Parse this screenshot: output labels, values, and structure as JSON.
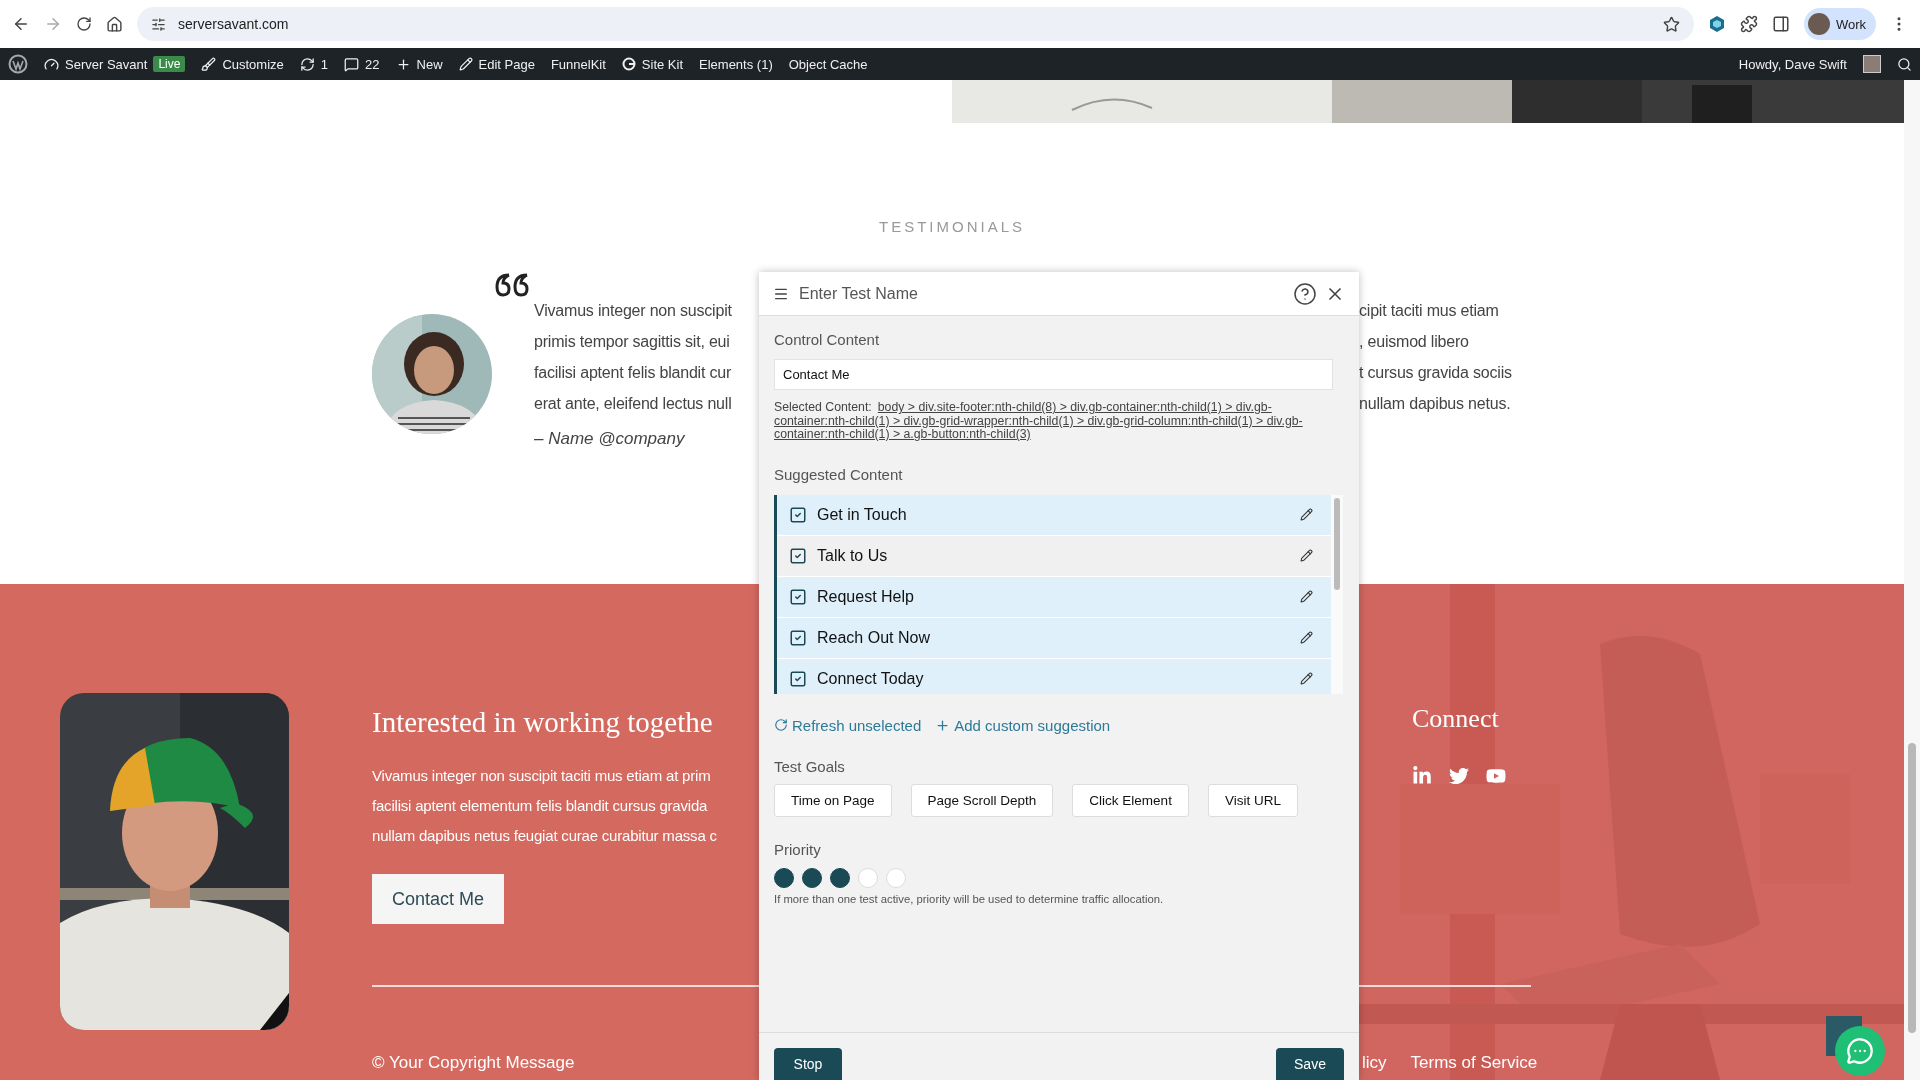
{
  "browser": {
    "url": "serversavant.com",
    "profile": "Work"
  },
  "admin_bar": {
    "items": [
      {
        "kind": "site",
        "label": "Server Savant",
        "badge": "Live"
      },
      {
        "kind": "customize",
        "label": "Customize"
      },
      {
        "kind": "updates",
        "label": "1"
      },
      {
        "kind": "comments",
        "label": "22"
      },
      {
        "kind": "new",
        "label": "New"
      },
      {
        "kind": "edit",
        "label": "Edit Page"
      },
      {
        "kind": "plain",
        "label": "FunnelKit"
      },
      {
        "kind": "sitekit",
        "label": "Site Kit"
      },
      {
        "kind": "plain",
        "label": "Elements (1)"
      },
      {
        "kind": "plain",
        "label": "Object Cache"
      }
    ],
    "greeting": "Howdy, Dave Swift"
  },
  "testimonials": {
    "heading": "TESTIMONIALS",
    "lines": [
      {
        "left": "Vivamus integer non suscipit",
        "right": "cipit taciti mus etiam"
      },
      {
        "left": "primis tempor sagittis sit, eui",
        "right": ", euismod libero"
      },
      {
        "left": "facilisi aptent felis blandit cur",
        "right": "t cursus gravida sociis"
      },
      {
        "left": "erat ante, eleifend lectus null",
        "right": "nullam dapibus netus."
      }
    ],
    "author": "– Name @company"
  },
  "footer": {
    "heading": "Interested in working togethe",
    "paragraph_lines": [
      "Vivamus integer non suscipit taciti mus etiam at prim",
      "facilisi aptent elementum felis blandit cursus gravida",
      "nullam dapibus netus feugiat curae curabitur massa c"
    ],
    "button": "Contact Me",
    "copyright": "© Your Copyright Message",
    "connect": "Connect",
    "links": [
      "licy",
      "Terms of Service"
    ]
  },
  "panel": {
    "title": {
      "placeholder": "Enter Test Name"
    },
    "control_label": "Control Content",
    "control": {
      "value": "Contact Me"
    },
    "selected_label": "Selected Content:",
    "selected_path": "body > div.site-footer:nth-child(8) > div.gb-container:nth-child(1) > div.gb-container:nth-child(1) > div.gb-grid-wrapper:nth-child(1) > div.gb-grid-column:nth-child(1) > div.gb-container:nth-child(1) > a.gb-button:nth-child(3)",
    "suggested_label": "Suggested Content",
    "suggestions": [
      {
        "label": "Get in Touch",
        "checked": true,
        "hovered": false
      },
      {
        "label": "Talk to Us",
        "checked": true,
        "hovered": true
      },
      {
        "label": "Request Help",
        "checked": true,
        "hovered": false
      },
      {
        "label": "Reach Out Now",
        "checked": true,
        "hovered": false
      },
      {
        "label": "Connect Today",
        "checked": true,
        "hovered": false
      }
    ],
    "actions": [
      {
        "kind": "refresh",
        "label": "Refresh unselected"
      },
      {
        "kind": "add",
        "label": "Add custom suggestion"
      }
    ],
    "goals_label": "Test Goals",
    "goals": [
      "Time on Page",
      "Page Scroll Depth",
      "Click Element",
      "Visit URL"
    ],
    "priority": {
      "label": "Priority",
      "stars": 3,
      "note": "If more than one test active, priority will be used to determine traffic allocation."
    },
    "stop": "Stop",
    "save": "Save"
  }
}
